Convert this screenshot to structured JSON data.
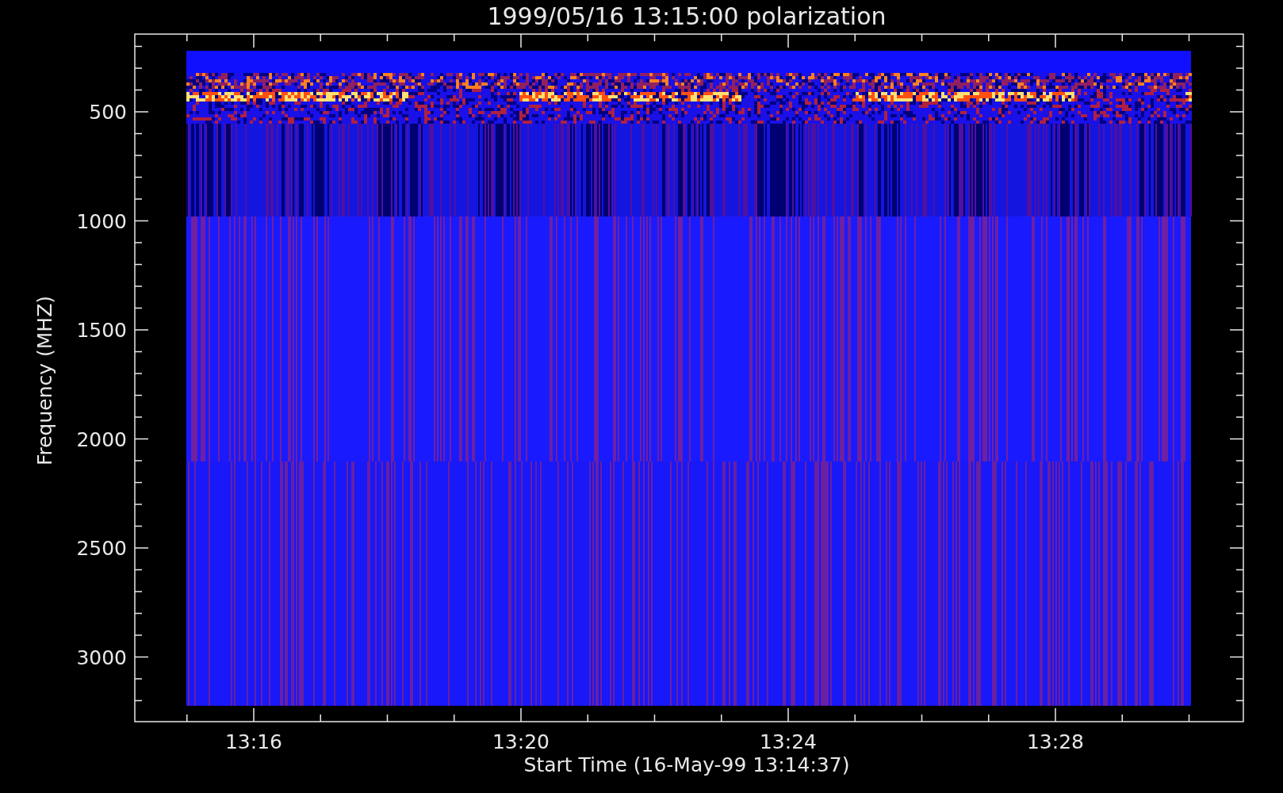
{
  "title": "1999/05/16 13:15:00 polarization",
  "y_axis": {
    "label": "Frequency (MHZ)",
    "ticks": [
      "500",
      "1000",
      "1500",
      "2000",
      "2500",
      "3000"
    ]
  },
  "x_axis": {
    "label": "Start Time (16-May-99 13:14:37)",
    "ticks": [
      "13:16",
      "13:20",
      "13:24",
      "13:28"
    ]
  }
}
